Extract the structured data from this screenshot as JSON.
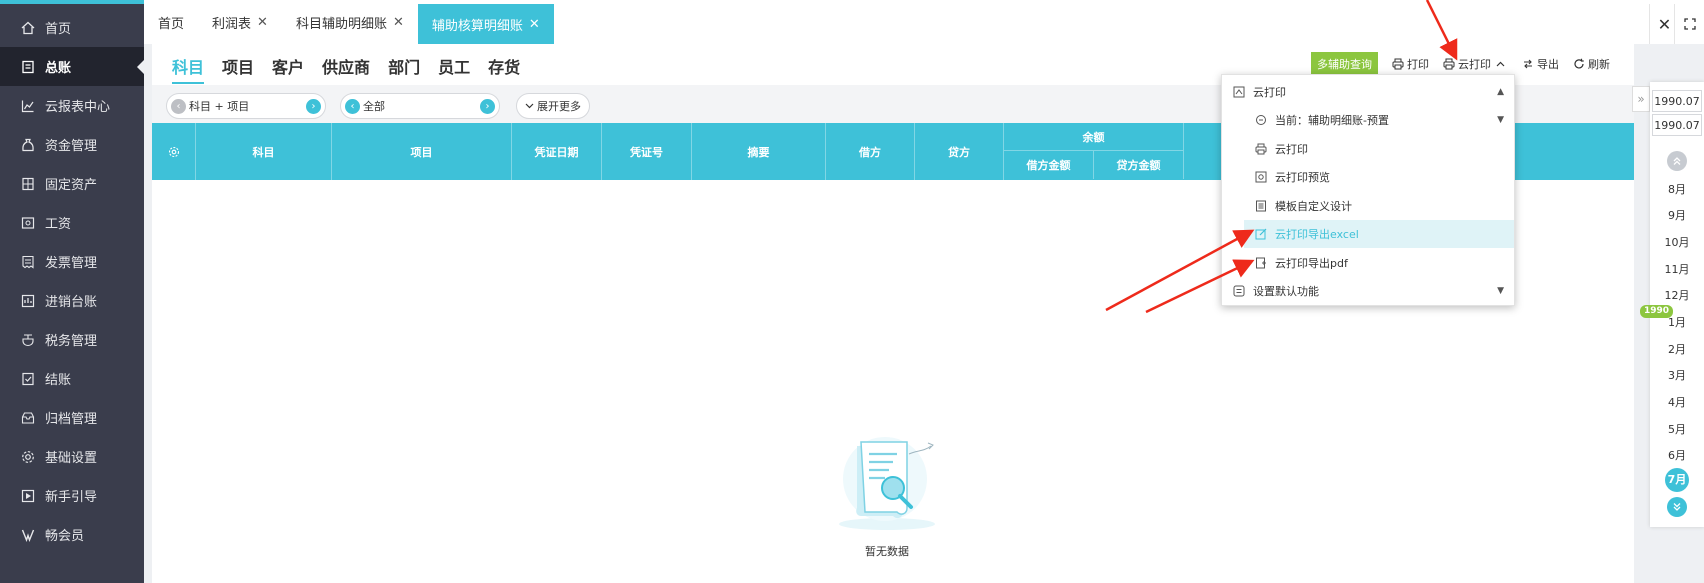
{
  "sidebar": {
    "items": [
      {
        "label": "首页",
        "icon": "home-icon"
      },
      {
        "label": "总账",
        "icon": "ledger-icon",
        "active": true
      },
      {
        "label": "云报表中心",
        "icon": "chart-icon"
      },
      {
        "label": "资金管理",
        "icon": "money-bag-icon"
      },
      {
        "label": "固定资产",
        "icon": "building-icon"
      },
      {
        "label": "工资",
        "icon": "payroll-icon"
      },
      {
        "label": "发票管理",
        "icon": "invoice-icon"
      },
      {
        "label": "进销台账",
        "icon": "inventory-icon"
      },
      {
        "label": "税务管理",
        "icon": "tax-icon"
      },
      {
        "label": "结账",
        "icon": "checkout-icon"
      },
      {
        "label": "归档管理",
        "icon": "archive-icon"
      },
      {
        "label": "基础设置",
        "icon": "settings-icon"
      },
      {
        "label": "新手引导",
        "icon": "guide-icon"
      },
      {
        "label": "畅会员",
        "icon": "member-icon"
      }
    ]
  },
  "tabs": [
    {
      "label": "首页",
      "closable": false
    },
    {
      "label": "利润表",
      "closable": true
    },
    {
      "label": "科目辅助明细账",
      "closable": true
    },
    {
      "label": "辅助核算明细账",
      "closable": true,
      "active": true
    }
  ],
  "subtabs": [
    "科目",
    "项目",
    "客户",
    "供应商",
    "部门",
    "员工",
    "存货"
  ],
  "toolbar": {
    "multi_query": "多辅助查询",
    "print": "打印",
    "cloud_print": "云打印",
    "export": "导出",
    "refresh": "刷新"
  },
  "filters": {
    "combo1": "科目 + 项目",
    "combo2": "全部",
    "expand": "展开更多"
  },
  "table": {
    "headers": [
      "科目",
      "项目",
      "凭证日期",
      "凭证号",
      "摘要",
      "借方",
      "贷方"
    ],
    "balance_group": "余额",
    "balance_sub": [
      "借方金额",
      "贷方金额"
    ]
  },
  "empty_text": "暂无数据",
  "dropdown": {
    "title": "云打印",
    "current": "当前：辅助明细账-预置",
    "items": [
      "云打印",
      "云打印预览",
      "模板自定义设计",
      "云打印导出excel",
      "云打印导出pdf"
    ],
    "default": "设置默认功能"
  },
  "date_rail": {
    "start": "1990.07",
    "end": "1990.07",
    "year_tag": "1990",
    "months_before": [
      "8月",
      "9月",
      "10月",
      "11月",
      "12月"
    ],
    "months_after": [
      "1月",
      "2月",
      "3月",
      "4月",
      "5月",
      "6月"
    ],
    "active_month": "7月"
  },
  "colors": {
    "accent": "#3ec1d8",
    "sidebar": "#3a3d4c",
    "green": "#8cc63f",
    "arrow": "#ee2a1b"
  }
}
